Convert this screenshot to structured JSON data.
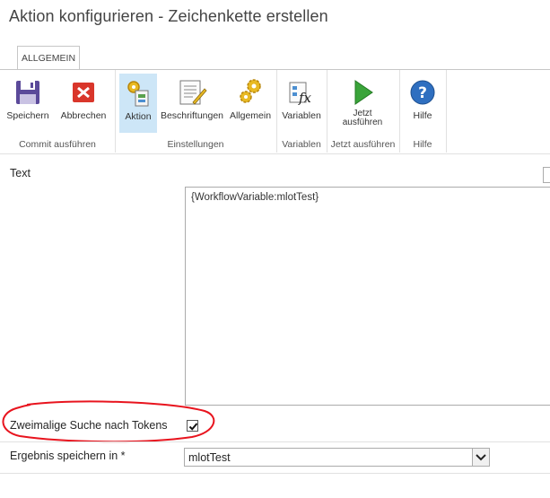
{
  "dialog": {
    "title": "Aktion konfigurieren - Zeichenkette erstellen"
  },
  "ribbon": {
    "tab": "ALLGEMEIN",
    "groups": {
      "commit": {
        "label": "Commit ausführen",
        "buttons": {
          "save": "Speichern",
          "cancel": "Abbrechen"
        }
      },
      "settings": {
        "label": "Einstellungen",
        "buttons": {
          "action": "Aktion",
          "labels": "Beschriftungen",
          "general": "Allgemein"
        }
      },
      "variables": {
        "label": "Variablen",
        "buttons": {
          "variables": "Variablen"
        }
      },
      "run": {
        "label": "Jetzt ausführen",
        "buttons": {
          "run_line1": "Jetzt",
          "run_line2": "ausführen"
        }
      },
      "help": {
        "label": "Hilfe",
        "buttons": {
          "help": "Hilfe"
        }
      }
    }
  },
  "form": {
    "text_label": "Text",
    "text_value": "{WorkflowVariable:mlotTest}",
    "double_token_label": "Zweimalige Suche nach Tokens",
    "double_token_checked": true,
    "result_label": "Ergebnis speichern in *",
    "result_value": "mlotTest"
  },
  "colors": {
    "selected_button_bg": "#cde6f7",
    "annotation_circle": "#e8141e"
  },
  "icons": {
    "save": "floppy-disk-icon",
    "cancel": "red-x-icon",
    "action": "gears-document-icon",
    "labels": "document-pencil-icon",
    "general": "gears-icon",
    "variables": "fx-variables-icon",
    "run": "green-play-icon",
    "help": "question-mark-icon"
  }
}
